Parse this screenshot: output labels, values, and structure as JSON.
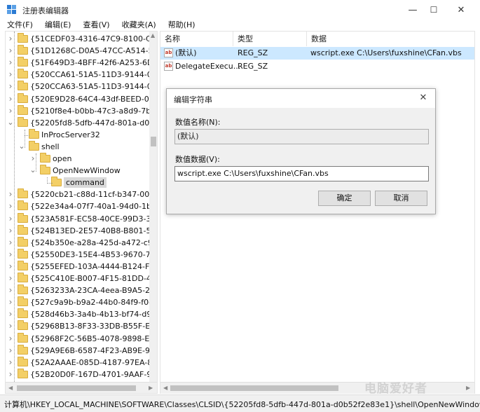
{
  "window": {
    "title": "注册表编辑器",
    "minimize": "—",
    "maximize": "☐",
    "close": "✕"
  },
  "menu": [
    "文件(F)",
    "编辑(E)",
    "查看(V)",
    "收藏夹(A)",
    "帮助(H)"
  ],
  "tree": {
    "items": [
      {
        "label": "{51CEDF03-4316-47C9-8100-CAC",
        "expanded": false
      },
      {
        "label": "{51D1268C-D0A5-47CC-A514-547",
        "expanded": false
      },
      {
        "label": "{51F649D3-4BFF-42f6-A253-6D87",
        "expanded": false
      },
      {
        "label": "{520CCA61-51A5-11D3-9144-0010",
        "expanded": false
      },
      {
        "label": "{520CCA63-51A5-11D3-9144-0010",
        "expanded": false
      },
      {
        "label": "{520E9D28-64C4-43df-BEED-02D9",
        "expanded": false
      },
      {
        "label": "{5210f8e4-b0bb-47c3-a8d9-7b22",
        "expanded": false
      },
      {
        "label": "{52205fd8-5dfb-447d-801a-d0b5",
        "expanded": true
      },
      {
        "label": "InProcServer32",
        "expanded": null
      },
      {
        "label": "shell",
        "expanded": true
      },
      {
        "label": "open",
        "expanded": false
      },
      {
        "label": "OpenNewWindow",
        "expanded": true
      },
      {
        "label": "command",
        "expanded": null,
        "selected": true
      },
      {
        "label": "{5220cb21-c88d-11cf-b347-00aa0",
        "expanded": false
      },
      {
        "label": "{522e34a4-07f7-40a1-94d0-1bfe8",
        "expanded": false
      },
      {
        "label": "{523A581F-EC58-40CE-99D3-36BF",
        "expanded": false
      },
      {
        "label": "{524B13ED-2E57-40B8-B801-5FA3",
        "expanded": false
      },
      {
        "label": "{524b350e-a28a-425d-a472-c9e2",
        "expanded": false
      },
      {
        "label": "{52550DE3-15E4-4B53-9670-74FC",
        "expanded": false
      },
      {
        "label": "{5255EFED-103A-4444-B124-F88F",
        "expanded": false
      },
      {
        "label": "{525C410E-B007-4F15-81DD-49D",
        "expanded": false
      },
      {
        "label": "{5263233A-23CA-4eea-B9A5-25A2",
        "expanded": false
      },
      {
        "label": "{527c9a9b-b9a2-44b0-84f9-f0dc1",
        "expanded": false
      },
      {
        "label": "{528d46b3-3a4b-4b13-bf74-d9cb",
        "expanded": false
      },
      {
        "label": "{52968B13-8F33-33DB-B55F-ED57",
        "expanded": false
      },
      {
        "label": "{52968F2C-56B5-4078-9898-EA59",
        "expanded": false
      },
      {
        "label": "{529A9E6B-6587-4F23-AB9E-9C7D",
        "expanded": false
      },
      {
        "label": "{52A2AAAE-085D-4187-97EA-8C3",
        "expanded": false
      },
      {
        "label": "{52B20D0F-167D-4701-9AAF-9E6C",
        "expanded": false
      }
    ]
  },
  "list": {
    "columns": [
      "名称",
      "类型",
      "数据"
    ],
    "rows": [
      {
        "name": "(默认)",
        "type": "REG_SZ",
        "data": "wscript.exe C:\\Users\\fuxshine\\CFan.vbs",
        "icon": "string-value-icon",
        "selected": true
      },
      {
        "name": "DelegateExecu...",
        "type": "REG_SZ",
        "data": "",
        "icon": "string-value-icon",
        "selected": false
      }
    ]
  },
  "dialog": {
    "title": "编辑字符串",
    "close": "✕",
    "name_label": "数值名称(N):",
    "name_value": "(默认)",
    "data_label": "数值数据(V):",
    "data_value": "wscript.exe C:\\Users\\fuxshine\\CFan.vbs",
    "ok": "确定",
    "cancel": "取消"
  },
  "status": {
    "path": "计算机\\HKEY_LOCAL_MACHINE\\SOFTWARE\\Classes\\CLSID\\{52205fd8-5dfb-447d-801a-d0b52f2e83e1}\\shell\\OpenNewWindow\\con"
  },
  "watermark": "电脑爱好者"
}
